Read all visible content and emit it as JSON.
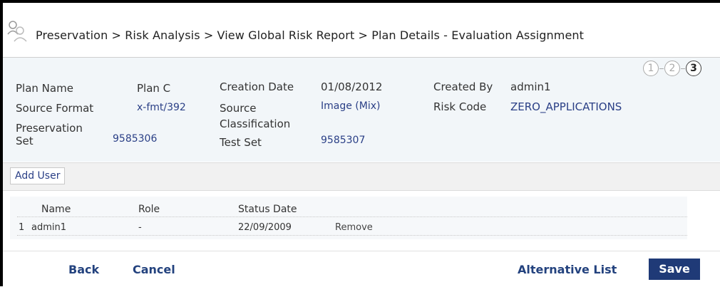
{
  "breadcrumb": "Preservation > Risk Analysis > View Global Risk Report > Plan Details - Evaluation Assignment",
  "steps": [
    "1",
    "2",
    "3"
  ],
  "plan": {
    "plan_name_label": "Plan Name",
    "plan_name_value": "Plan C",
    "creation_date_label": "Creation Date",
    "creation_date_value": "01/08/2012",
    "created_by_label": "Created By",
    "created_by_value": "admin1",
    "source_format_label": "Source Format",
    "source_format_value": "x-fmt/392",
    "source_class_label_line1": "Source",
    "source_class_label_line2": "Classification",
    "source_class_value": "Image (Mix)",
    "risk_code_label": "Risk Code",
    "risk_code_value": "ZERO_APPLICATIONS",
    "preservation_set_label_line1": "Preservation",
    "preservation_set_label_line2": "Set",
    "preservation_set_value": "9585306",
    "test_set_label": "Test Set",
    "test_set_value": "9585307"
  },
  "add_user_label": "Add User",
  "table": {
    "headers": [
      "Name",
      "Role",
      "Status Date"
    ],
    "rows": [
      {
        "index": "1",
        "name": "admin1",
        "role": "-",
        "status_date": "22/09/2009",
        "action": "Remove"
      }
    ]
  },
  "footer": {
    "back": "Back",
    "cancel": "Cancel",
    "alternative_list": "Alternative List",
    "save": "Save"
  },
  "colors": {
    "link": "#2a3f86",
    "save_bg": "#1f3a77",
    "panel_bg": "#f2f6f9"
  }
}
